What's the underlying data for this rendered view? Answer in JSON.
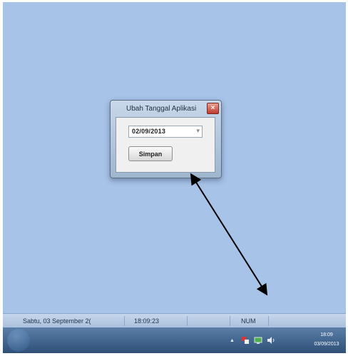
{
  "dialog": {
    "title": "Ubah Tanggal Aplikasi",
    "close_label": "×",
    "date_value": "02/09/2013",
    "save_label": "Simpan"
  },
  "statusbar": {
    "date": "Sabtu, 03 September 2(",
    "time": "18:09:23",
    "num": "NUM"
  },
  "taskbar": {
    "show_hidden_icon": "▲",
    "clock_time": "18:09",
    "clock_date": "03/09/2013"
  },
  "icons": {
    "dropdown": "chevron-down-icon",
    "close": "close-icon",
    "volume": "speaker-icon",
    "network": "network-icon",
    "flag": "action-center-icon"
  },
  "colors": {
    "desktop": "#a7c3e8",
    "taskbar": "#2f4f77",
    "close_button": "#c0392b",
    "arrow": "#000000"
  }
}
